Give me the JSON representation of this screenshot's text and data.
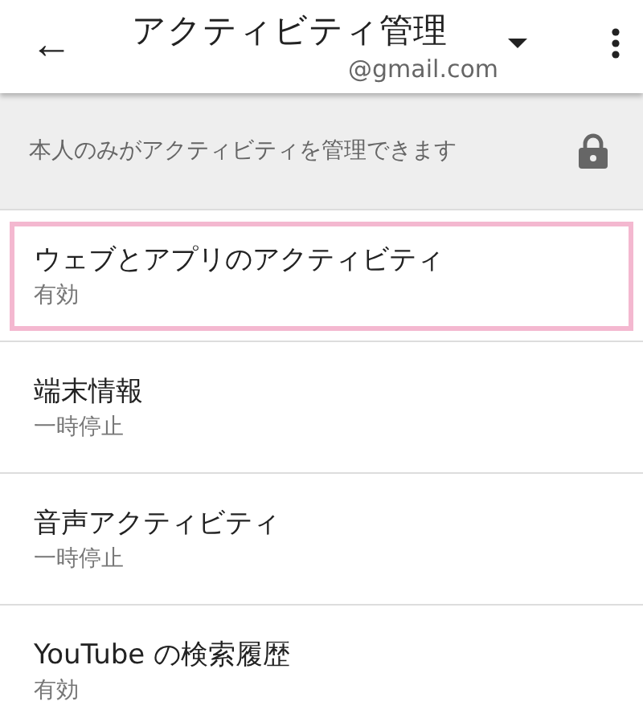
{
  "app_bar": {
    "back": "←",
    "title": "アクティビティ管理",
    "account": "@gmail.com"
  },
  "notice": {
    "text": "本人のみがアクティビティを管理できます"
  },
  "items": [
    {
      "title": "ウェブとアプリのアクティビティ",
      "status": "有効",
      "highlighted": true
    },
    {
      "title": "端末情報",
      "status": "一時停止",
      "highlighted": false
    },
    {
      "title": "音声アクティビティ",
      "status": "一時停止",
      "highlighted": false
    },
    {
      "title": "YouTube の検索履歴",
      "status": "有効",
      "highlighted": false
    }
  ]
}
